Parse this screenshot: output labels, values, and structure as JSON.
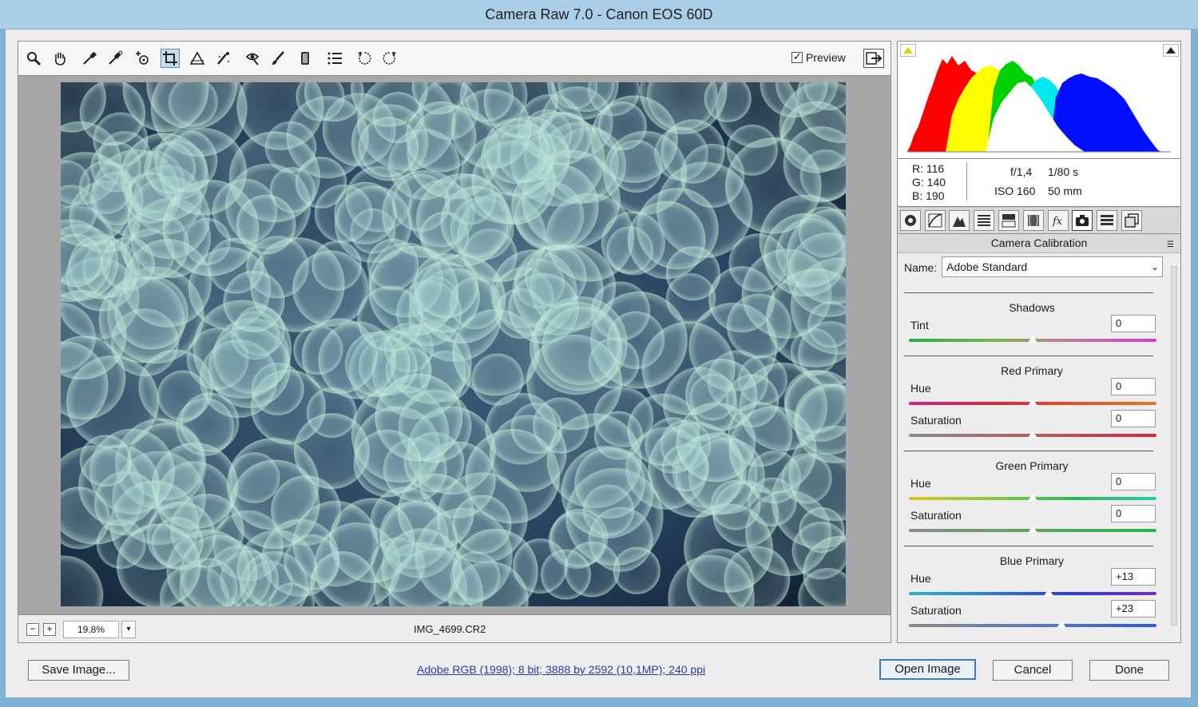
{
  "window": {
    "title": "Camera Raw 7.0  -  Canon EOS 60D"
  },
  "toolbar": {
    "tools": [
      {
        "icon": "zoom-icon",
        "active": false
      },
      {
        "icon": "hand-icon",
        "active": false
      },
      {
        "icon": "white-balance-icon",
        "active": false
      },
      {
        "icon": "color-sampler-icon",
        "active": false
      },
      {
        "icon": "targeted-adjustment-icon",
        "active": false
      },
      {
        "icon": "crop-icon",
        "active": true
      },
      {
        "icon": "straighten-icon",
        "active": false
      },
      {
        "icon": "spot-removal-icon",
        "active": false
      },
      {
        "icon": "red-eye-icon",
        "active": false
      },
      {
        "icon": "adjustment-brush-icon",
        "active": false
      },
      {
        "icon": "graduated-filter-icon",
        "active": false
      },
      {
        "icon": "preferences-icon",
        "active": false
      },
      {
        "icon": "rotate-left-icon",
        "active": false
      },
      {
        "icon": "rotate-right-icon",
        "active": false
      }
    ],
    "preview_label": "Preview",
    "preview_checked": true
  },
  "statusbar": {
    "zoom_out": "−",
    "zoom_in": "+",
    "zoom_value": "19,8%",
    "zoom_dropdown": "▾",
    "filename": "IMG_4699.CR2"
  },
  "info": {
    "r": "R:  116",
    "g": "G:  140",
    "b": "B:  190",
    "aperture": "f/1,4",
    "shutter": "1/80 s",
    "iso": "ISO 160",
    "focal": "50 mm"
  },
  "panel_tabs": [
    {
      "icon": "basic-icon",
      "active": false
    },
    {
      "icon": "tone-curve-icon",
      "active": false
    },
    {
      "icon": "detail-icon",
      "active": false
    },
    {
      "icon": "hsl-icon",
      "active": false
    },
    {
      "icon": "split-toning-icon",
      "active": false
    },
    {
      "icon": "lens-corrections-icon",
      "active": false
    },
    {
      "icon": "effects-icon",
      "active": false
    },
    {
      "icon": "camera-calibration-icon",
      "active": true
    },
    {
      "icon": "presets-icon",
      "active": false
    },
    {
      "icon": "snapshots-icon",
      "active": false
    }
  ],
  "panel": {
    "title": "Camera Calibration",
    "name_label": "Name:",
    "name_value": "Adobe Standard",
    "groups": [
      {
        "title": "Shadows",
        "sliders": [
          {
            "label": "Tint",
            "value": "0",
            "level": 0.5,
            "gradient": "linear-gradient(to right,#2aa84a,#7ab84a,#c07aa0,#d23cc8)"
          }
        ]
      },
      {
        "title": "Red Primary",
        "sliders": [
          {
            "label": "Hue",
            "value": "0",
            "level": 0.5,
            "gradient": "linear-gradient(to right,#c82a8a,#d8263a,#e0502a,#e07a2a)"
          },
          {
            "label": "Saturation",
            "value": "0",
            "level": 0.5,
            "gradient": "linear-gradient(to right,#8a8a8a,#b06060,#d2283a)"
          }
        ]
      },
      {
        "title": "Green Primary",
        "sliders": [
          {
            "label": "Hue",
            "value": "0",
            "level": 0.5,
            "gradient": "linear-gradient(to right,#d8c82a,#8ac83a,#2ab85a,#2ac8b8)"
          },
          {
            "label": "Saturation",
            "value": "0",
            "level": 0.5,
            "gradient": "linear-gradient(to right,#8a8a8a,#60a060,#2ab84a)"
          }
        ]
      },
      {
        "title": "Blue Primary",
        "sliders": [
          {
            "label": "Hue",
            "value": "+13",
            "level": 0.565,
            "gradient": "linear-gradient(to right,#2ab8c8,#2a7ad8,#2a3ad8,#7a2ad8)"
          },
          {
            "label": "Saturation",
            "value": "+23",
            "level": 0.615,
            "gradient": "linear-gradient(to right,#8a8a8a,#5a7ab8,#2a5ad8)"
          }
        ]
      }
    ]
  },
  "footer": {
    "save_label": "Save Image...",
    "workflow": "Adobe RGB (1998); 8 bit; 3888 by 2592 (10,1MP); 240 ppi",
    "open_label": "Open Image",
    "cancel_label": "Cancel",
    "done_label": "Done"
  }
}
